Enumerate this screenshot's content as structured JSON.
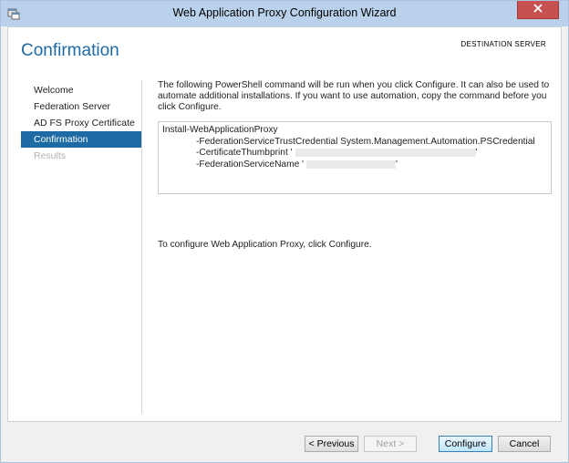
{
  "window": {
    "title": "Web Application Proxy Configuration Wizard"
  },
  "header": {
    "page_title": "Confirmation",
    "destination_server_label": "DESTINATION SERVER"
  },
  "nav": {
    "items": [
      {
        "label": "Welcome",
        "state": "normal"
      },
      {
        "label": "Federation Server",
        "state": "normal"
      },
      {
        "label": "AD FS Proxy Certificate",
        "state": "normal"
      },
      {
        "label": "Confirmation",
        "state": "active"
      },
      {
        "label": "Results",
        "state": "disabled"
      }
    ]
  },
  "main": {
    "intro": "The following PowerShell command will be run when you click Configure. It can also be used to automate additional installations. If you want to use automation, copy the command before you click Configure.",
    "command": {
      "line1": "Install-WebApplicationProxy",
      "line2": "-FederationServiceTrustCredential System.Management.Automation.PSCredential",
      "line3": "-CertificateThumbprint '",
      "line3_end": "'",
      "line4": "-FederationServiceName '",
      "line4_end": "'"
    },
    "outro": "To configure Web Application Proxy, click Configure."
  },
  "buttons": {
    "previous": "< Previous",
    "next": "Next >",
    "configure": "Configure",
    "cancel": "Cancel"
  },
  "colors": {
    "accent": "#1e6aa5",
    "titlebar": "#b9d1ea",
    "close": "#c75050"
  },
  "icons": {
    "app": "wizard-app-icon",
    "close": "close-icon"
  }
}
